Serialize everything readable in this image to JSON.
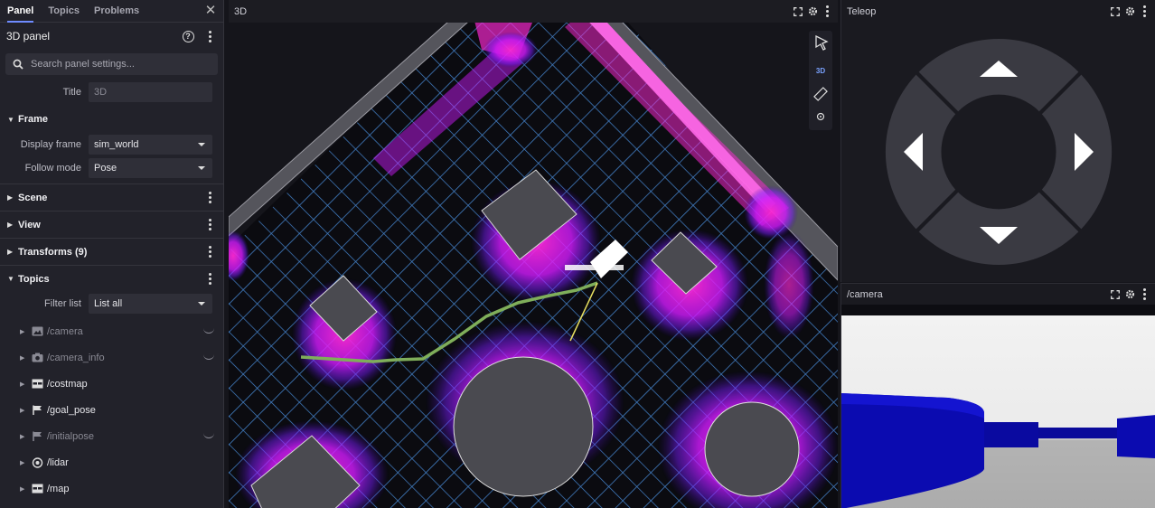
{
  "sidebar": {
    "tabs": [
      "Panel",
      "Topics",
      "Problems"
    ],
    "panel_title": "3D panel",
    "search_placeholder": "Search panel settings...",
    "title_label": "Title",
    "title_value": "3D",
    "sections": {
      "frame": "Frame",
      "scene": "Scene",
      "view": "View",
      "transforms": "Transforms (9)",
      "topics": "Topics"
    },
    "display_frame_label": "Display frame",
    "display_frame_value": "sim_world",
    "follow_mode_label": "Follow mode",
    "follow_mode_value": "Pose",
    "filter_list_label": "Filter list",
    "filter_list_value": "List all",
    "topic_items": [
      {
        "name": "/camera",
        "icon": "image-icon",
        "visible": false
      },
      {
        "name": "/camera_info",
        "icon": "camera-icon",
        "visible": false
      },
      {
        "name": "/costmap",
        "icon": "grid-icon",
        "visible": true
      },
      {
        "name": "/goal_pose",
        "icon": "flag-icon",
        "visible": true
      },
      {
        "name": "/initialpose",
        "icon": "flag-icon",
        "visible": false
      },
      {
        "name": "/lidar",
        "icon": "lidar-icon",
        "visible": true
      },
      {
        "name": "/map",
        "icon": "grid-icon",
        "visible": true
      }
    ]
  },
  "panel3d": {
    "title": "3D",
    "mode_label": "3D"
  },
  "teleop": {
    "title": "Teleop"
  },
  "camera": {
    "title": "/camera"
  },
  "colors": {
    "accent": "#6f8cff",
    "grid": "#4a90e0",
    "costmap_magenta": "#ff22cc",
    "costmap_purple": "#7a1cff",
    "camera_blue": "#0b0bb0"
  }
}
